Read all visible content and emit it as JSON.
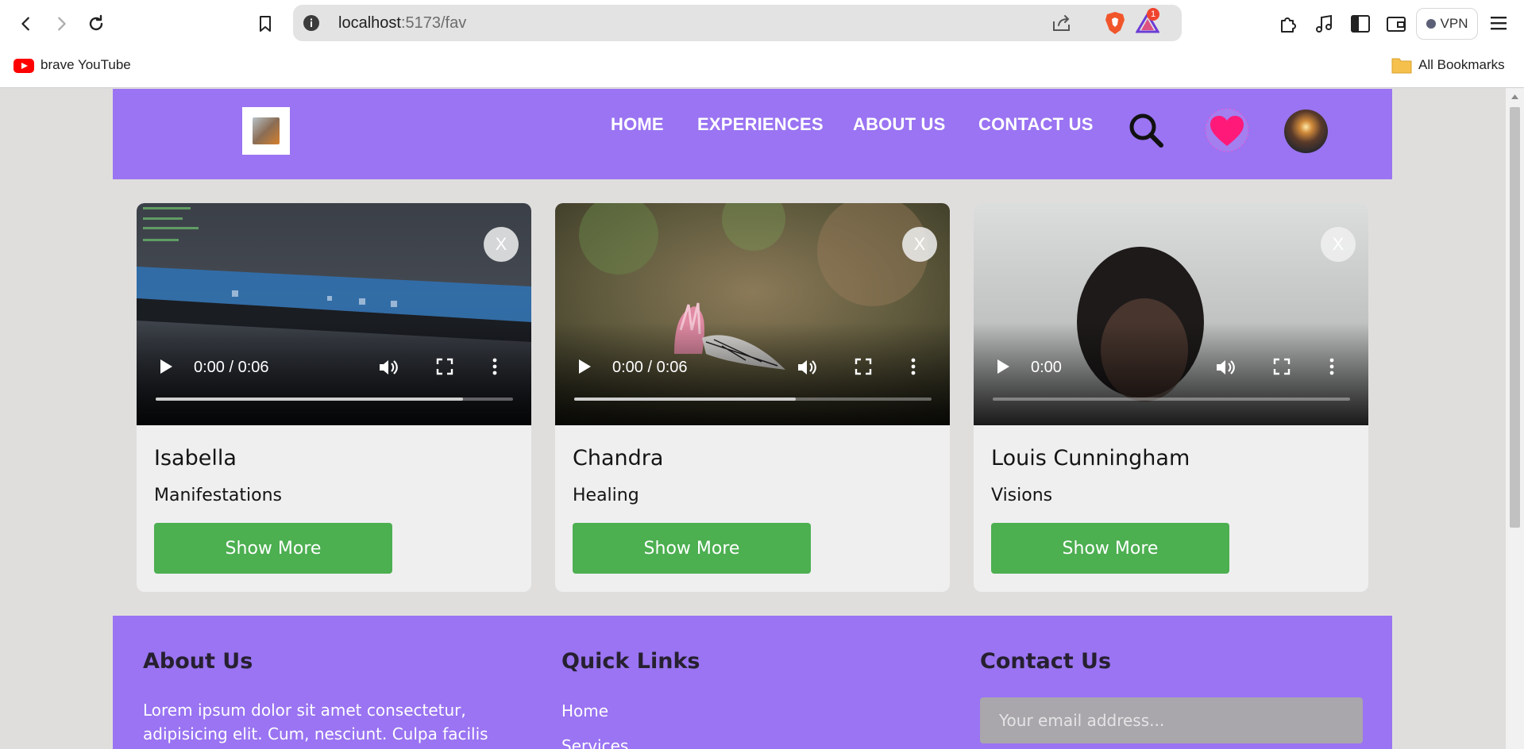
{
  "browser": {
    "url_host": "localhost",
    "url_path": ":5173/fav",
    "notification_count": "1",
    "vpn_label": "VPN",
    "bookmarks": [
      {
        "label": "brave YouTube"
      }
    ],
    "all_bookmarks_label": "All Bookmarks"
  },
  "header": {
    "nav": [
      "HOME",
      "EXPERIENCES",
      "ABOUT US",
      "CONTACT US"
    ]
  },
  "cards": [
    {
      "name": "Isabella",
      "category": "Manifestations",
      "time": "0:00 / 0:06",
      "progress": 0.86,
      "button": "Show More",
      "close": "X"
    },
    {
      "name": "Chandra",
      "category": "Healing",
      "time": "0:00 / 0:06",
      "progress": 0.62,
      "button": "Show More",
      "close": "X"
    },
    {
      "name": "Louis Cunningham",
      "category": "Visions",
      "time": "0:00",
      "progress": 0.0,
      "button": "Show More",
      "close": "X"
    }
  ],
  "footer": {
    "about_title": "About Us",
    "about_text": "Lorem ipsum dolor sit amet consectetur, adipisicing elit. Cum, nesciunt. Culpa facilis",
    "links_title": "Quick Links",
    "links": [
      "Home",
      "Services"
    ],
    "contact_title": "Contact Us",
    "email_placeholder": "Your email address..."
  },
  "colors": {
    "header_bg": "#9a74f2",
    "button_green": "#4caf50",
    "heart_pink": "#ff1a7a"
  }
}
